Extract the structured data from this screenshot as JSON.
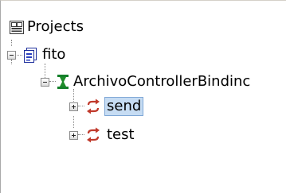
{
  "tree": {
    "root": {
      "label": "Projects",
      "icon": "projects-icon"
    },
    "project": {
      "label": "fito",
      "icon": "project-document-icon",
      "expanded": true
    },
    "binding": {
      "label": "ArchivoControllerBindinc",
      "icon": "binding-hourglass-icon",
      "expanded": true
    },
    "operations": [
      {
        "label": "send",
        "icon": "operation-arrows-icon",
        "selected": true,
        "expanded": false
      },
      {
        "label": "test",
        "icon": "operation-arrows-icon",
        "selected": false,
        "expanded": false
      }
    ]
  },
  "colors": {
    "selection": "#c6dcf3",
    "project_icon": "#2a3fbf",
    "binding_icon": "#1e8c2a",
    "operation_icon": "#c0392b"
  }
}
